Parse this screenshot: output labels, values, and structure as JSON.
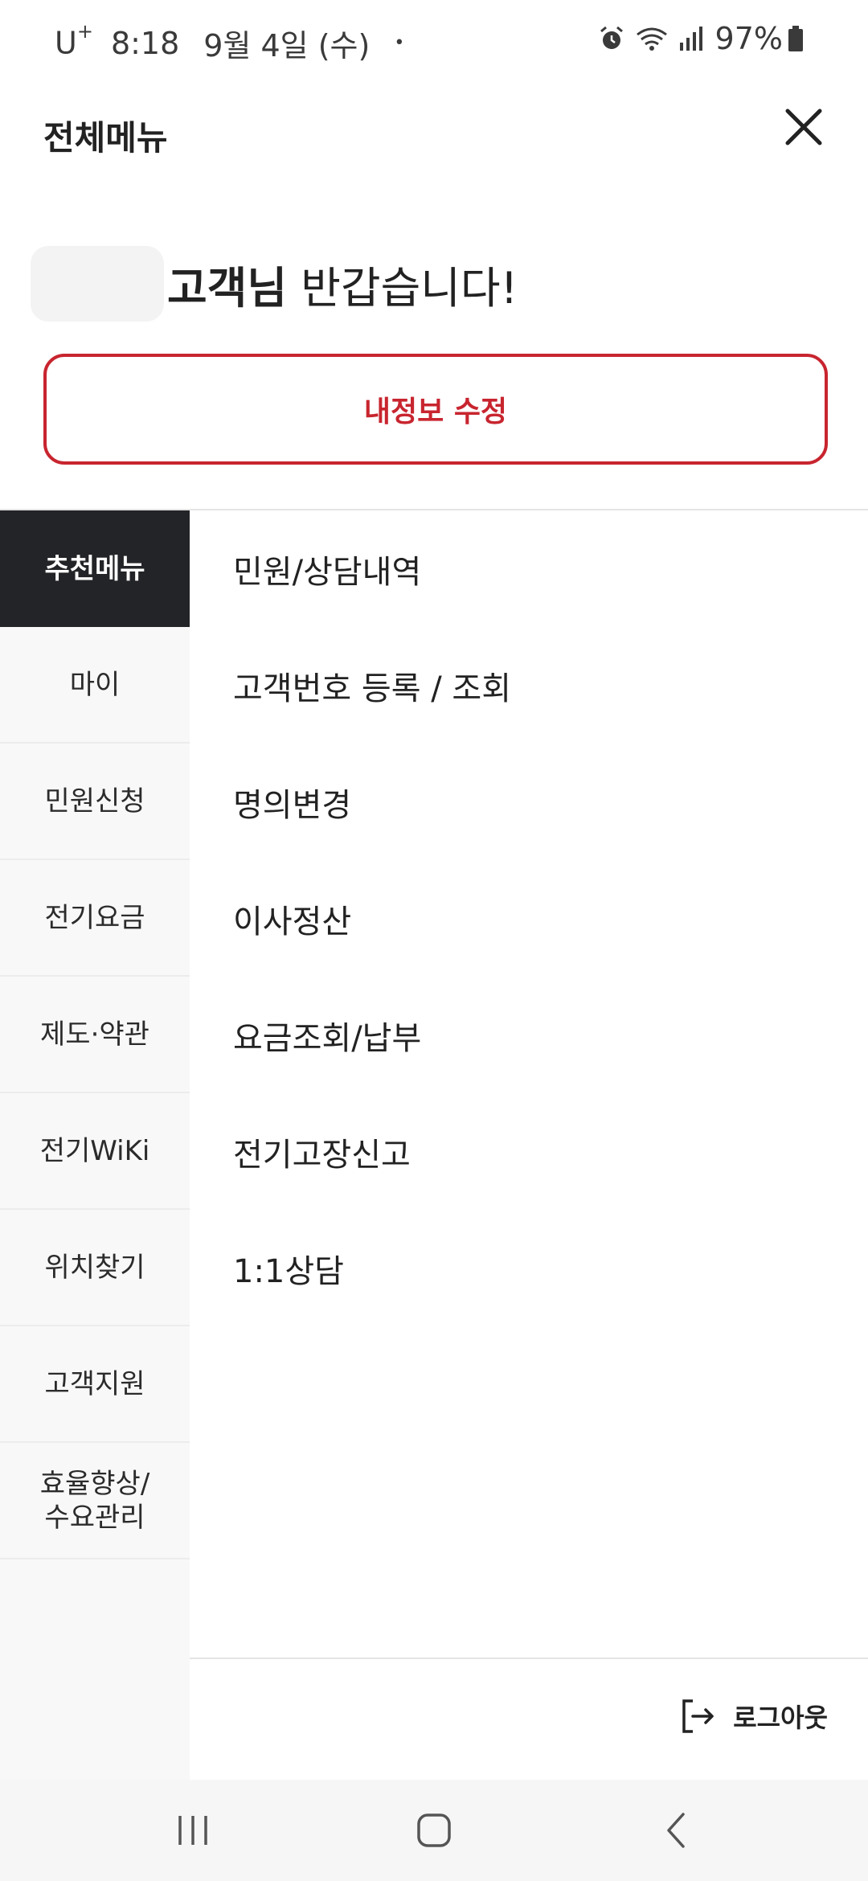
{
  "status_bar": {
    "carrier": "U",
    "carrier_sup": "+",
    "time": "8:18",
    "date": "9월 4일 (수)",
    "dot": "•",
    "battery": "97%"
  },
  "header": {
    "title": "전체메뉴"
  },
  "greeting": {
    "name_bold": "고객님",
    "message": " 반갑습니다!"
  },
  "edit_profile_label": "내정보 수정",
  "sidebar": {
    "items": [
      {
        "label": "추천메뉴",
        "active": true
      },
      {
        "label": "마이"
      },
      {
        "label": "민원신청"
      },
      {
        "label": "전기요금"
      },
      {
        "label": "제도·약관"
      },
      {
        "label": "전기WiKi"
      },
      {
        "label": "위치찾기"
      },
      {
        "label": "고객지원"
      },
      {
        "label": "효율향상/\n수요관리"
      }
    ]
  },
  "main": {
    "items": [
      {
        "label": "민원/상담내역"
      },
      {
        "label": "고객번호 등록 / 조회"
      },
      {
        "label": "명의변경"
      },
      {
        "label": "이사정산"
      },
      {
        "label": "요금조회/납부"
      },
      {
        "label": "전기고장신고"
      },
      {
        "label": "1:1상담"
      }
    ]
  },
  "logout_label": "로그아웃",
  "colors": {
    "accent": "#c8252f",
    "active_bg": "#232427"
  }
}
